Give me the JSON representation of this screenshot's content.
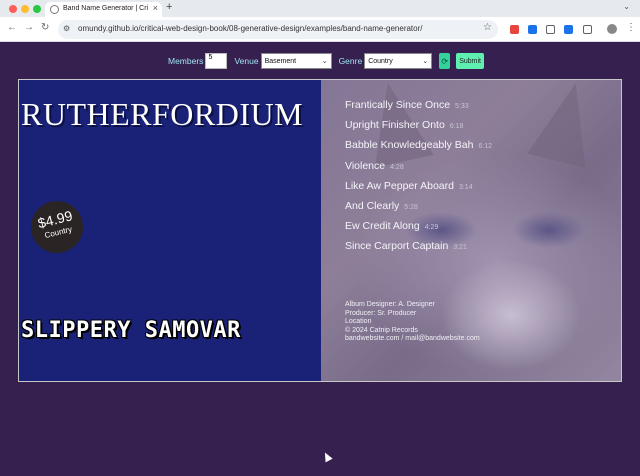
{
  "browser": {
    "tab_title": "Band Name Generator | Criti",
    "new_tab": "+",
    "url": "omundy.github.io/critical-web-design-book/08-generative-design/examples/band-name-generator/",
    "icons": [
      "back-icon",
      "forward-icon",
      "reload-icon",
      "site-info-icon",
      "bookmark-star-icon",
      "extension-icon",
      "profile-avatar",
      "menu-kebab-icon"
    ],
    "extension_colors": [
      "#e8453c",
      "#1a73e8",
      "#5f6368",
      "#1a73e8"
    ]
  },
  "controls": {
    "members_label": "Members",
    "members_value": "5",
    "venue_label": "Venue",
    "venue_value": "Basement",
    "genre_label": "Genre",
    "genre_value": "Country",
    "refresh_icon": "refresh-icon",
    "submit_label": "Submit"
  },
  "album": {
    "band_name": "RUTHERFORDIUM",
    "price": "$4.99",
    "price_genre": "Country",
    "album_title": "SLIPPERY SAMOVAR",
    "tracks": [
      {
        "name": "Frantically Since Once",
        "duration": "5:33"
      },
      {
        "name": "Upright Finisher Onto",
        "duration": "6:18"
      },
      {
        "name": "Babble Knowledgeably Bah",
        "duration": "6:12"
      },
      {
        "name": "Violence",
        "duration": "4:28"
      },
      {
        "name": "Like Aw Pepper Aboard",
        "duration": "3:14"
      },
      {
        "name": "And Clearly",
        "duration": "5:28"
      },
      {
        "name": "Ew Credit Along",
        "duration": "4:29"
      },
      {
        "name": "Since Carport Captain",
        "duration": "3:21"
      }
    ],
    "credits": {
      "designer": "Album Designer: A. Designer",
      "producer": "Producer: Sr. Producer",
      "location": "Location",
      "copyright": "© 2024 Catnip Records",
      "contact": "bandwebsite.com / mail@bandwebsite.com"
    },
    "colors": {
      "left_panel": "#1a2277",
      "page_bg": "#36204f"
    }
  }
}
